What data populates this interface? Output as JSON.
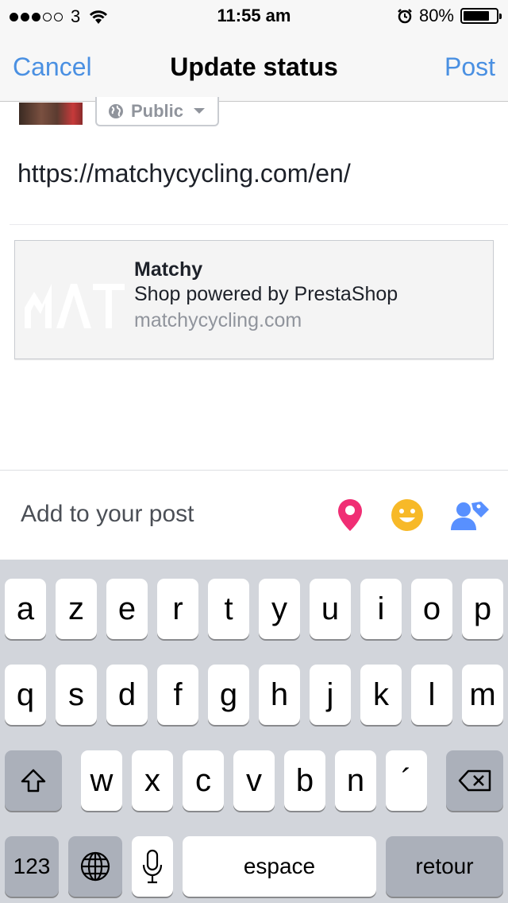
{
  "status_bar": {
    "carrier": "3",
    "time": "11:55 am",
    "battery": "80%",
    "battery_level": 0.8,
    "icons": [
      "signal-dots",
      "wifi-icon",
      "alarm-icon",
      "battery-icon"
    ]
  },
  "nav": {
    "cancel": "Cancel",
    "title": "Update status",
    "post": "Post"
  },
  "composer": {
    "audience": "Public",
    "status_text": "https://matchycycling.com/en/"
  },
  "link_preview": {
    "title": "Matchy",
    "description": "Shop powered by PrestaShop",
    "domain": "matchycycling.com"
  },
  "add_to_post": {
    "label": "Add to your post",
    "icons": [
      "location-pin-icon",
      "smiley-icon",
      "tag-people-icon"
    ]
  },
  "keyboard": {
    "row1": [
      "a",
      "z",
      "e",
      "r",
      "t",
      "y",
      "u",
      "i",
      "o",
      "p"
    ],
    "row2": [
      "q",
      "s",
      "d",
      "f",
      "g",
      "h",
      "j",
      "k",
      "l",
      "m"
    ],
    "row3": [
      "w",
      "x",
      "c",
      "v",
      "b",
      "n",
      "´"
    ],
    "numbers": "123",
    "space": "espace",
    "return": "retour"
  },
  "colors": {
    "accent": "#4a90e2",
    "pin": "#f02e74",
    "smiley": "#f7b928",
    "tag": "#5890ff"
  }
}
